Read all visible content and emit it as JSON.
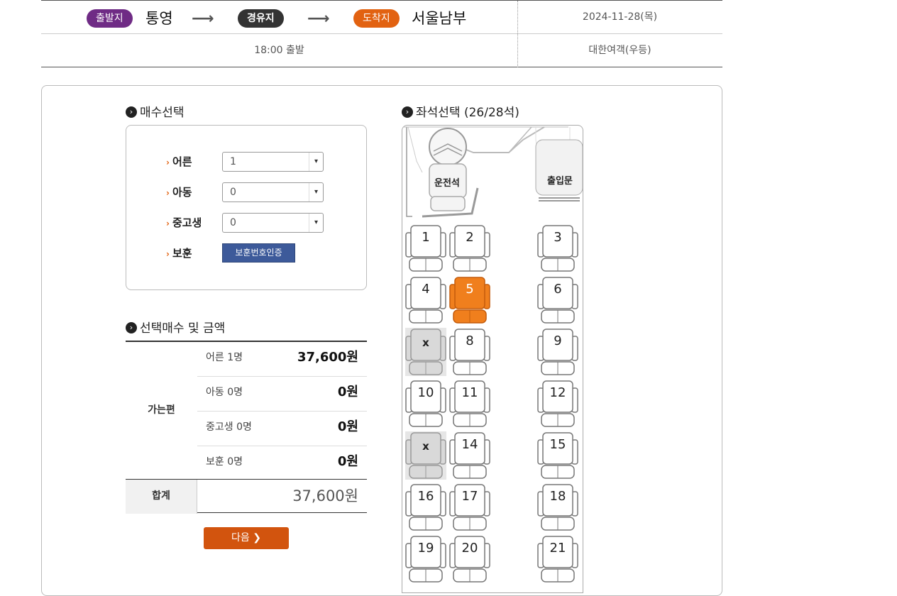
{
  "route": {
    "departure_tag": "출발지",
    "departure_city": "통영",
    "via_tag": "경유지",
    "arrival_tag": "도착지",
    "arrival_city": "서울남부",
    "date": "2024-11-28(목)",
    "departure_time": "18:00 출발",
    "company": "대한여객(우등)",
    "arrow": "⟶"
  },
  "quantity": {
    "title": "매수선택",
    "rows": [
      {
        "label": "어른",
        "value": "1"
      },
      {
        "label": "아동",
        "value": "0"
      },
      {
        "label": "중고생",
        "value": "0"
      }
    ],
    "veteran_label": "보훈",
    "veteran_button": "보훈번호인증"
  },
  "price": {
    "title": "선택매수 및 금액",
    "direction_label": "가는편",
    "rows": [
      {
        "label": "어른 1명",
        "amount": "37,600원"
      },
      {
        "label": "아동 0명",
        "amount": "0원"
      },
      {
        "label": "중고생 0명",
        "amount": "0원"
      },
      {
        "label": "보훈 0명",
        "amount": "0원"
      }
    ],
    "total_label": "합계",
    "total_amount": "37,600원"
  },
  "next_button": "다음",
  "seat_map": {
    "title": "좌석선택 (26/28석)",
    "driver_label": "운전석",
    "door_label": "출입문",
    "seats": [
      {
        "label": "1",
        "state": "available"
      },
      {
        "label": "2",
        "state": "available"
      },
      {
        "label": "3",
        "state": "available"
      },
      {
        "label": "4",
        "state": "available"
      },
      {
        "label": "5",
        "state": "selected"
      },
      {
        "label": "6",
        "state": "available"
      },
      {
        "label": "x",
        "state": "sold"
      },
      {
        "label": "8",
        "state": "available"
      },
      {
        "label": "9",
        "state": "available"
      },
      {
        "label": "10",
        "state": "available"
      },
      {
        "label": "11",
        "state": "available"
      },
      {
        "label": "12",
        "state": "available"
      },
      {
        "label": "x",
        "state": "sold"
      },
      {
        "label": "14",
        "state": "available"
      },
      {
        "label": "15",
        "state": "available"
      },
      {
        "label": "16",
        "state": "available"
      },
      {
        "label": "17",
        "state": "available"
      },
      {
        "label": "18",
        "state": "available"
      },
      {
        "label": "19",
        "state": "available"
      },
      {
        "label": "20",
        "state": "available"
      },
      {
        "label": "21",
        "state": "available"
      }
    ]
  },
  "colors": {
    "departure_tag": "#6f2b85",
    "arrival_tag": "#e26211",
    "selected_seat": "#f07f1d",
    "sold_seat": "#d9d9d9",
    "next_button": "#d2540e",
    "veteran_button": "#3d5a9a"
  }
}
